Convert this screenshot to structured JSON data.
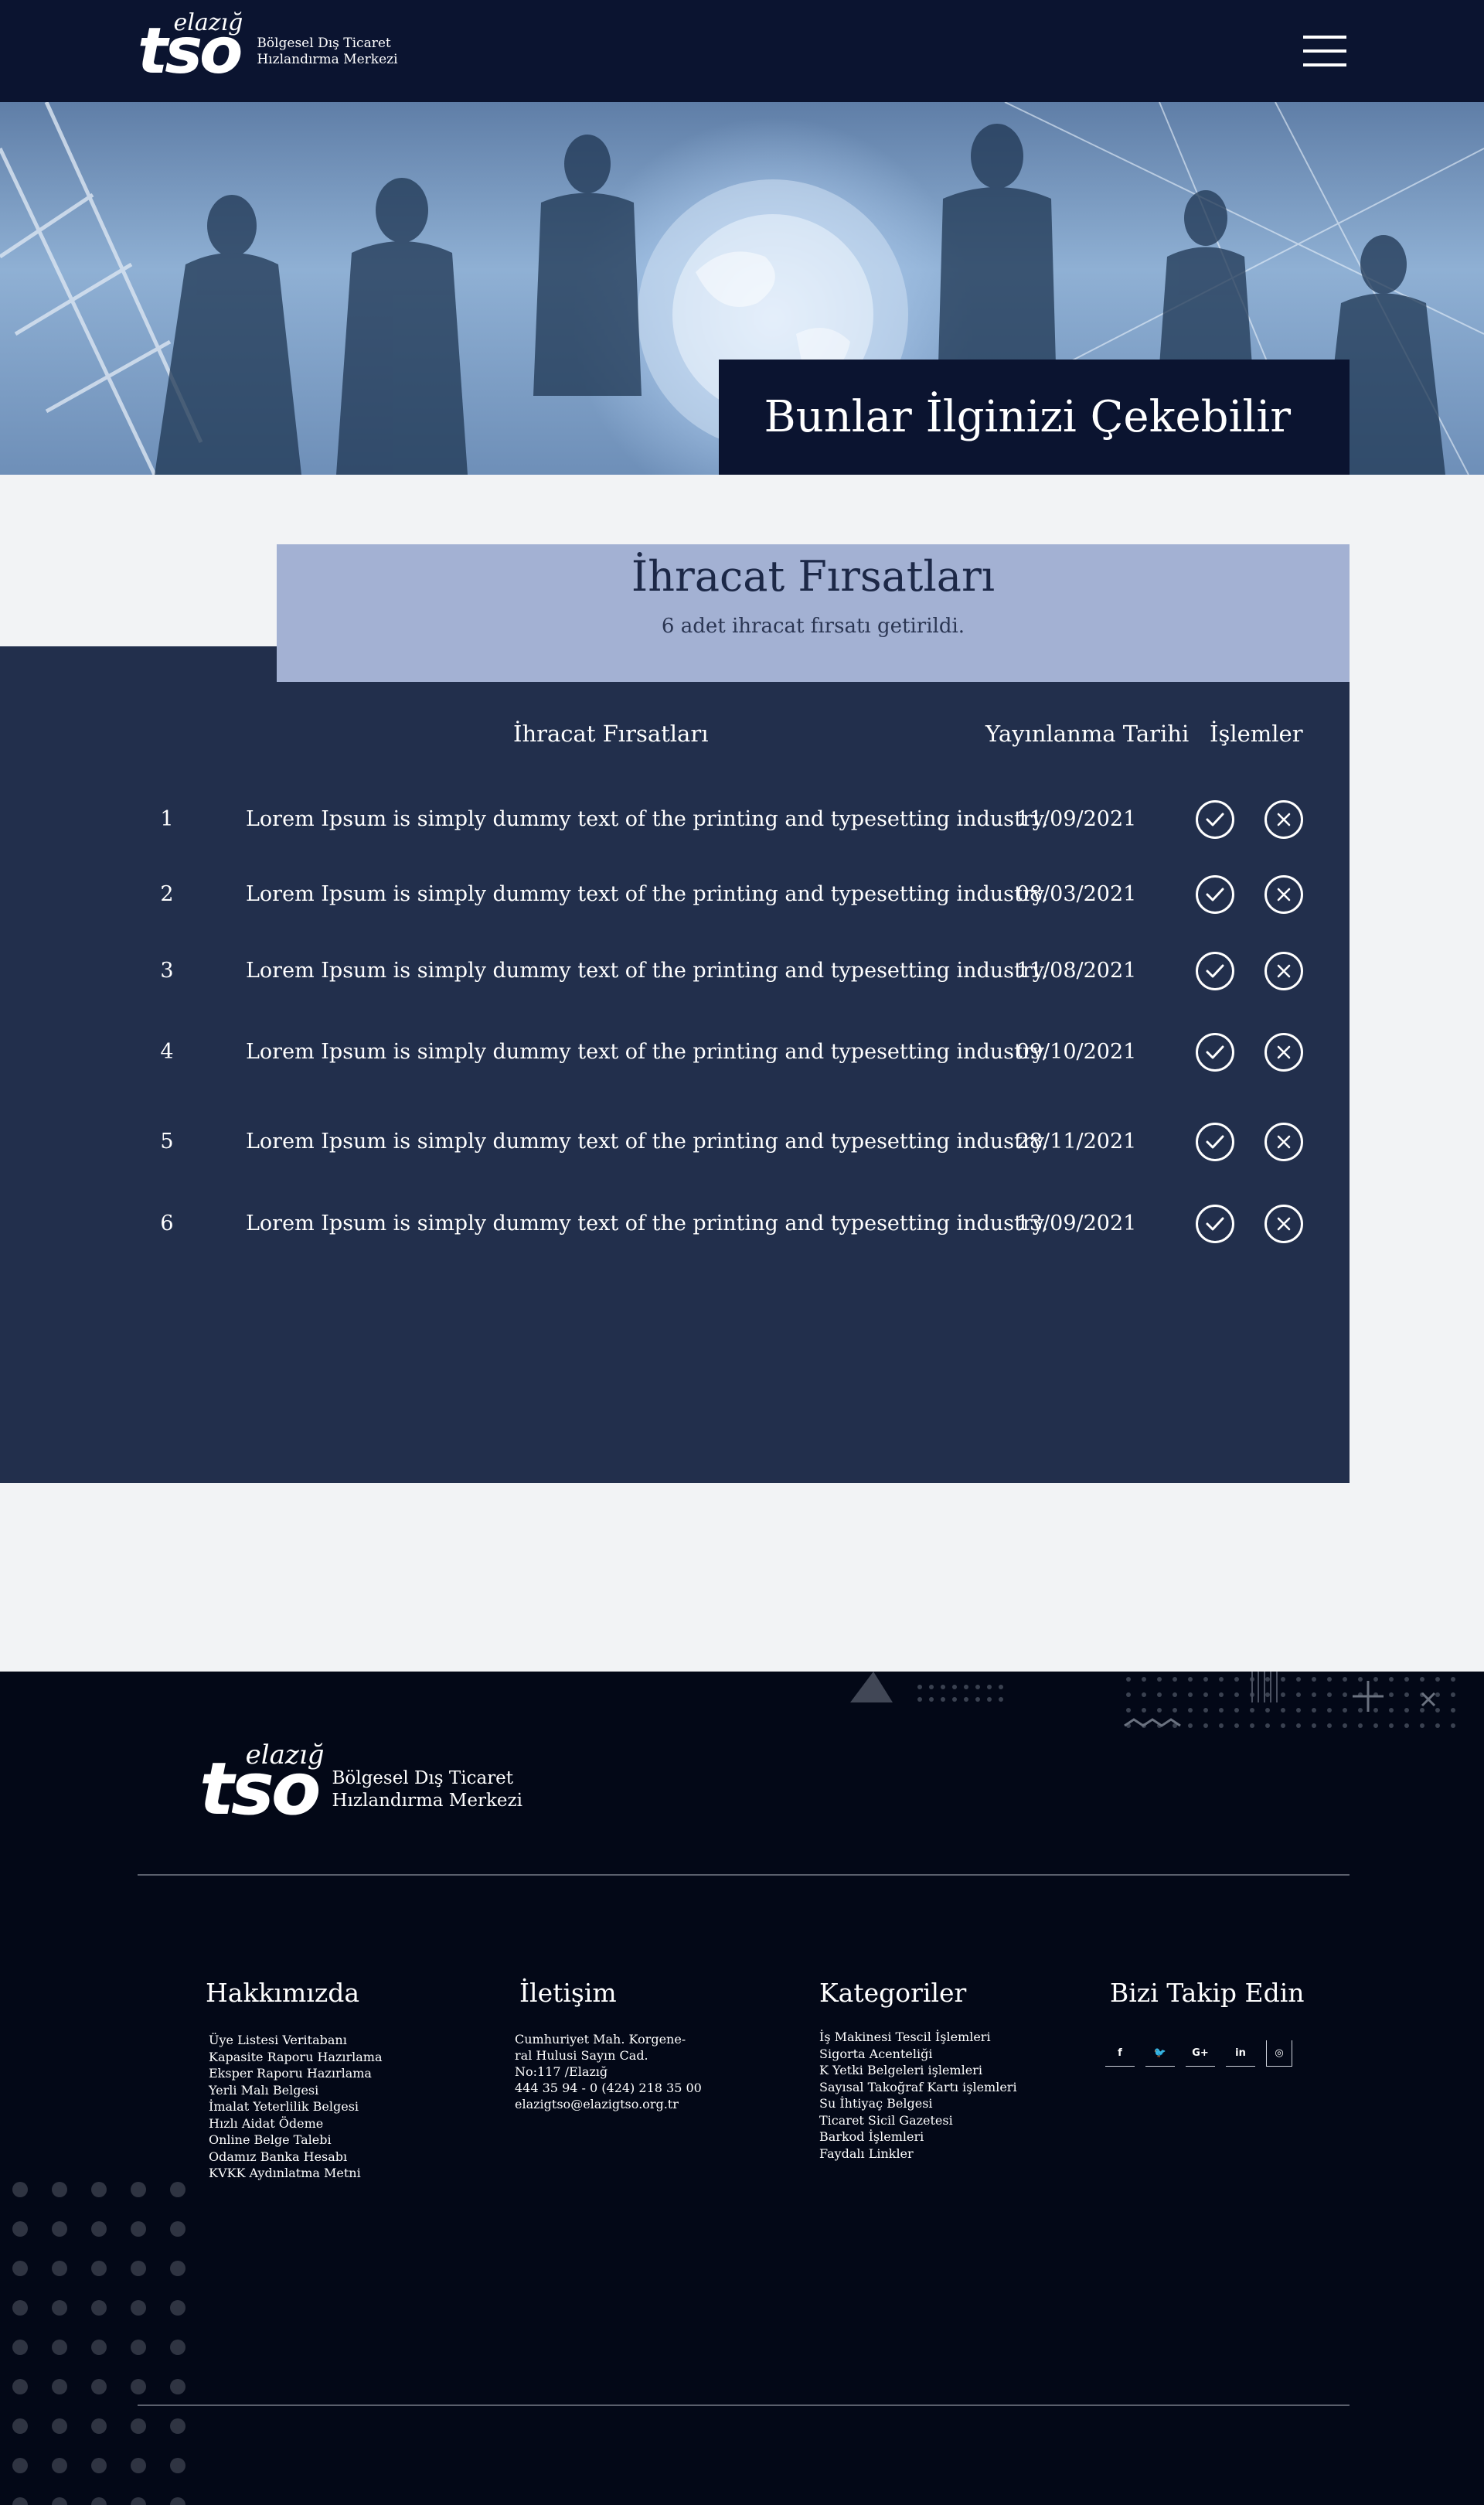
{
  "header": {
    "logo_script": "elazığ",
    "logo_mark": "tso",
    "logo_line1": "Bölgesel Dış Ticaret",
    "logo_line2": "Hızlandırma Merkezi",
    "menu_icon": "hamburger-icon"
  },
  "hero": {
    "title": "Bunlar İlginizi Çekebilir"
  },
  "section": {
    "title": "İhracat Fırsatları",
    "subtitle": "6 adet ihracat fırsatı getirildi."
  },
  "table": {
    "columns": [
      "İhracat Fırsatları",
      "Yayınlanma Tarihi",
      "İşlemler"
    ],
    "rows": [
      {
        "no": "1",
        "text": "Lorem Ipsum is simply dummy text of the printing and typesetting industry.",
        "date": "11/09/2021"
      },
      {
        "no": "2",
        "text": "Lorem Ipsum is simply dummy text of the printing and typesetting industry.",
        "date": "08/03/2021"
      },
      {
        "no": "3",
        "text": "Lorem Ipsum is simply dummy text of the printing and typesetting industry.",
        "date": "11/08/2021"
      },
      {
        "no": "4",
        "text": "Lorem Ipsum is simply dummy text of the printing and typesetting industry.",
        "date": "09/10/2021"
      },
      {
        "no": "5",
        "text": "Lorem Ipsum is simply dummy text of the printing and typesetting industry.",
        "date": "28/11/2021"
      },
      {
        "no": "6",
        "text": "Lorem Ipsum is simply dummy text of the printing and typesetting industry.",
        "date": "13/09/2021"
      }
    ],
    "action_icons": [
      "check-circle-icon",
      "close-circle-icon"
    ]
  },
  "footer": {
    "logo_script": "elazığ",
    "logo_mark": "tso",
    "logo_line1": "Bölgesel Dış Ticaret",
    "logo_line2": "Hızlandırma Merkezi",
    "about": {
      "title": "Hakkımızda",
      "items": [
        "Üye Listesi Veritabanı",
        "Kapasite Raporu Hazırlama",
        "Eksper Raporu Hazırlama",
        "Yerli Malı Belgesi",
        "İmalat Yeterlilik Belgesi",
        "Hızlı Aidat Ödeme",
        "Online Belge Talebi",
        "Odamız Banka Hesabı",
        "KVKK Aydınlatma Metni"
      ]
    },
    "contact": {
      "title": "İletişim",
      "lines": [
        "Cumhuriyet Mah. Korgene-",
        "ral Hulusi Sayın Cad.",
        "No:117 /Elazığ",
        "444 35 94 - 0 (424) 218 35 00",
        "elazigtso@elazigtso.org.tr"
      ]
    },
    "categories": {
      "title": "Kategoriler",
      "items": [
        "İş Makinesi Tescil İşlemleri",
        "Sigorta Acenteliği",
        "K Yetki Belgeleri işlemleri",
        "Sayısal Takoğraf Kartı işlemleri",
        "Su İhtiyaç Belgesi",
        "Ticaret Sicil Gazetesi",
        "Barkod İşlemleri",
        "Faydalı Linkler"
      ]
    },
    "follow": {
      "title": "Bizi Takip Edin",
      "social": [
        {
          "icon": "facebook-icon",
          "glyph": "f"
        },
        {
          "icon": "twitter-icon",
          "glyph": "🐦"
        },
        {
          "icon": "google-plus-icon",
          "glyph": "G+"
        },
        {
          "icon": "linkedin-icon",
          "glyph": "in"
        },
        {
          "icon": "instagram-icon",
          "glyph": "◎"
        }
      ]
    }
  },
  "colors": {
    "navy": "#0b1430",
    "panel": "#222f4c",
    "panel_head": "#a3b1d3",
    "footer": "#030817",
    "page_bg": "#f2f3f5"
  }
}
